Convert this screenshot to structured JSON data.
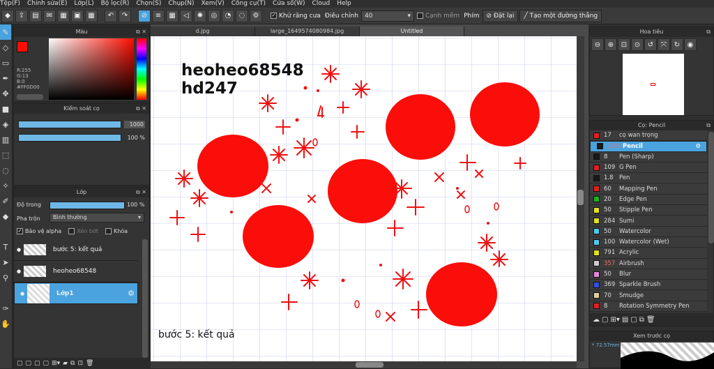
{
  "menu": [
    "Tệp(F)",
    "Chỉnh sửa(E)",
    "Lớp(L)",
    "Bộ lọc(R)",
    "Chọn(S)",
    "Chụp(N)",
    "Xem(V)",
    "Công cụ(T)",
    "Cửa sổ(W)",
    "Cloud",
    "Help"
  ],
  "toolbar": {
    "antialias_label": "Khử răng cưa",
    "adjust_label": "Điều chỉnh",
    "adjust_value": "40",
    "sharp_label": "Cạnh mềm",
    "keys_label": "Phím",
    "reset_label": "Đặt lại",
    "line_label": "Tạo một đường thẳng"
  },
  "color_panel": {
    "title": "Màu",
    "r": "R:255",
    "g": "G:13",
    "b": "B:0",
    "hex": "#FF0D00",
    "fg": "#FF0D00",
    "bg": "#FFFFFF"
  },
  "brush_control": {
    "title": "Kiểm soát cọ",
    "size": "1000",
    "opacity": "100 %"
  },
  "layers": {
    "title": "Lớp",
    "opacity_label": "Độ trong",
    "opacity_value": "100 %",
    "blend_label": "Pha trộn",
    "blend_value": "Bình thường",
    "protect_alpha": "Bảo vệ alpha",
    "clip": "Xén bớt",
    "lock": "Khóa",
    "items": [
      {
        "name": "bước 5: kết quả"
      },
      {
        "name": "heoheo68548"
      },
      {
        "name": "Lớp1"
      }
    ]
  },
  "tabs": [
    "d.jpg",
    "large_1649574080984.jpg",
    "Untitled"
  ],
  "canvas": {
    "text1": "heoheo68548",
    "text2": "hd247",
    "caption": "bước 5: kết quả"
  },
  "navigator": {
    "title": "Hoa tiêu"
  },
  "brushes": {
    "title": "Cọ: Pencil",
    "items": [
      {
        "size": "17",
        "name": "cọ wan trọng",
        "color": "#e02020"
      },
      {
        "size": "1000",
        "name": "Pencil",
        "color": "#1a1a1a"
      },
      {
        "size": "8",
        "name": "Pen (Sharp)",
        "color": "#1a1a1a"
      },
      {
        "size": "109",
        "name": "G Pen",
        "color": "#e02020"
      },
      {
        "size": "1.8",
        "name": "Pen",
        "color": "#1a1a1a"
      },
      {
        "size": "60",
        "name": "Mapping Pen",
        "color": "#e02020"
      },
      {
        "size": "20",
        "name": "Edge Pen",
        "color": "#20b020"
      },
      {
        "size": "50",
        "name": "Stipple Pen",
        "color": "#e0e020"
      },
      {
        "size": "284",
        "name": "Sumi",
        "color": "#e0e020"
      },
      {
        "size": "50",
        "name": "Watercolor",
        "color": "#50c8e8"
      },
      {
        "size": "100",
        "name": "Watercolor (Wet)",
        "color": "#50c8e8"
      },
      {
        "size": "791",
        "name": "Acrylic",
        "color": "#e0e020"
      },
      {
        "size": "357",
        "name": "Airbrush",
        "color": "#cccccc"
      },
      {
        "size": "50",
        "name": "Blur",
        "color": "#e088e0"
      },
      {
        "size": "369",
        "name": "Sparkle Brush",
        "color": "#3050e0"
      },
      {
        "size": "70",
        "name": "Smudge",
        "color": "#e0d0a0"
      },
      {
        "size": "8",
        "name": "Rotation Symmetry Pen",
        "color": "#e02020"
      }
    ]
  },
  "preview": {
    "title": "Xem trước cọ",
    "size": "72.57mm"
  }
}
